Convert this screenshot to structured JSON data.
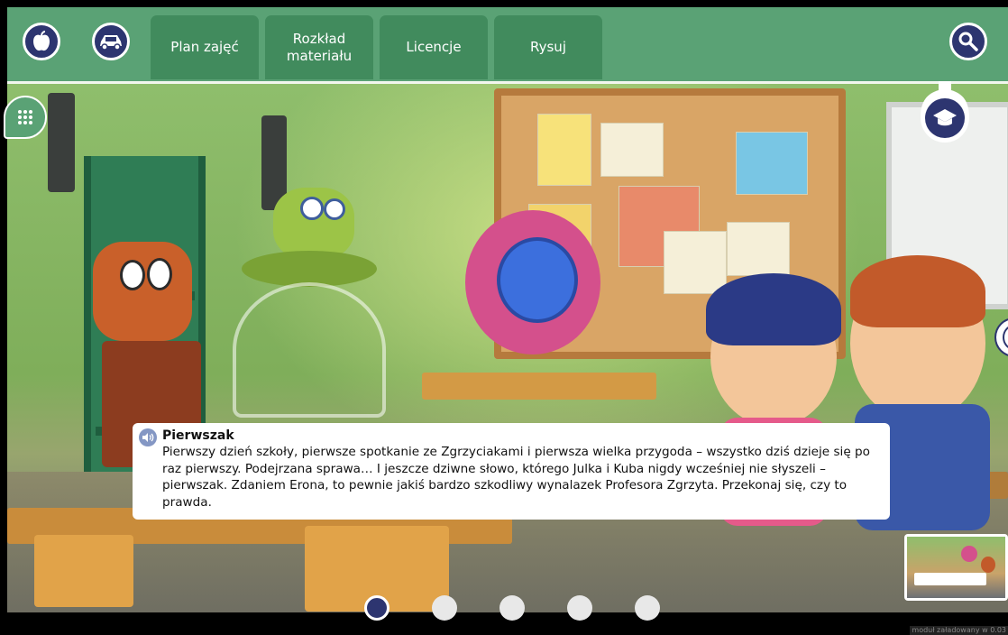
{
  "nav": {
    "tabs": [
      {
        "label": "Plan zajęć"
      },
      {
        "label": "Rozkład materiału"
      },
      {
        "label": "Licencje"
      },
      {
        "label": "Rysuj"
      }
    ]
  },
  "caption": {
    "title": "Pierwszak",
    "text": "Pierwszy dzień szkoły, pierwsze spotkanie ze Zgrzyciakami i pierwsza wielka przygoda – wszystko dziś dzieje się po raz pierwszy. Podejrzana sprawa… I jeszcze dziwne słowo, którego Julka i Kuba nigdy wcześniej nie słyszeli – pierwszak. Zdaniem Erona, to pewnie jakiś bardzo szkodliwy wynalazek Profesora Zgrzyta. Przekonaj się, czy to prawda."
  },
  "pagination": {
    "total": 5,
    "current": 1
  },
  "footer": {
    "version": "moduł załadowany w 0.03"
  },
  "icons": {
    "apple": "apple-icon",
    "car": "car-icon",
    "search": "search-icon",
    "apps": "apps-grid-icon",
    "graduation": "graduation-cap-icon",
    "audio": "speaker-icon",
    "next": "chevron-right-icon"
  },
  "colors": {
    "nav_bar": "#5aa275",
    "tab": "#418b5d",
    "icon_navy": "#2d3570",
    "active_dot": "#2d3570"
  }
}
